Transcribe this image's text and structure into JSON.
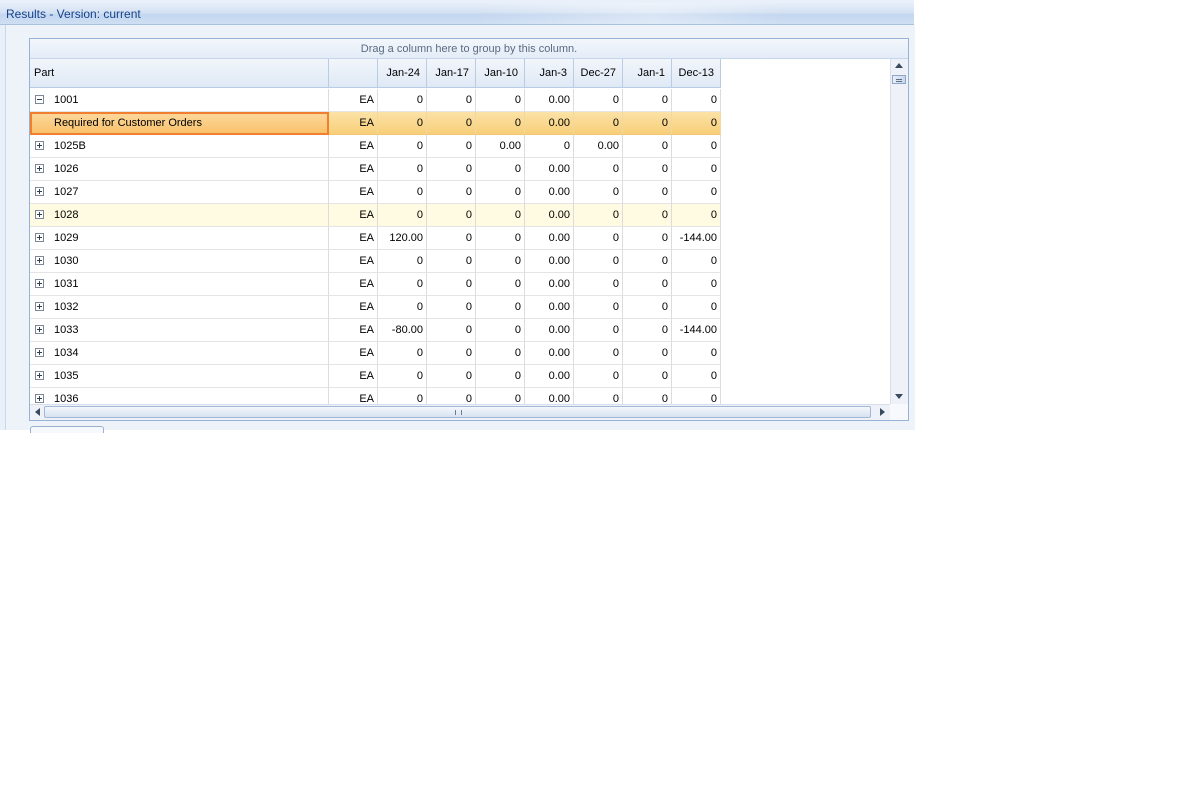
{
  "window": {
    "title": "Results - Version: current"
  },
  "grid": {
    "group_panel_text": "Drag a column here to group by this column.",
    "columns": [
      "Part",
      "",
      "Jan-24",
      "Jan-17",
      "Jan-10",
      "Jan-3",
      "Dec-27",
      "Jan-1",
      "Dec-13"
    ],
    "rows": [
      {
        "part": "1001",
        "expander": "collapse",
        "uom": "EA",
        "values": [
          "0",
          "0",
          "0",
          "0.00",
          "0",
          "0",
          "0"
        ]
      },
      {
        "part": "Required for Customer Orders",
        "expander": "none",
        "uom": "EA",
        "values": [
          "0",
          "0",
          "0",
          "0.00",
          "0",
          "0",
          "0"
        ],
        "state": "selected"
      },
      {
        "part": "1025B",
        "expander": "expand",
        "uom": "EA",
        "values": [
          "0",
          "0",
          "0.00",
          "0",
          "0.00",
          "0",
          "0"
        ]
      },
      {
        "part": "1026",
        "expander": "expand",
        "uom": "EA",
        "values": [
          "0",
          "0",
          "0",
          "0.00",
          "0",
          "0",
          "0"
        ]
      },
      {
        "part": "1027",
        "expander": "expand",
        "uom": "EA",
        "values": [
          "0",
          "0",
          "0",
          "0.00",
          "0",
          "0",
          "0"
        ]
      },
      {
        "part": "1028",
        "expander": "expand",
        "uom": "EA",
        "values": [
          "0",
          "0",
          "0",
          "0.00",
          "0",
          "0",
          "0"
        ],
        "state": "hover"
      },
      {
        "part": "1029",
        "expander": "expand",
        "uom": "EA",
        "values": [
          "120.00",
          "0",
          "0",
          "0.00",
          "0",
          "0",
          "-144.00"
        ]
      },
      {
        "part": "1030",
        "expander": "expand",
        "uom": "EA",
        "values": [
          "0",
          "0",
          "0",
          "0.00",
          "0",
          "0",
          "0"
        ]
      },
      {
        "part": "1031",
        "expander": "expand",
        "uom": "EA",
        "values": [
          "0",
          "0",
          "0",
          "0.00",
          "0",
          "0",
          "0"
        ]
      },
      {
        "part": "1032",
        "expander": "expand",
        "uom": "EA",
        "values": [
          "0",
          "0",
          "0",
          "0.00",
          "0",
          "0",
          "0"
        ]
      },
      {
        "part": "1033",
        "expander": "expand",
        "uom": "EA",
        "values": [
          "-80.00",
          "0",
          "0",
          "0.00",
          "0",
          "0",
          "-144.00"
        ]
      },
      {
        "part": "1034",
        "expander": "expand",
        "uom": "EA",
        "values": [
          "0",
          "0",
          "0",
          "0.00",
          "0",
          "0",
          "0"
        ]
      },
      {
        "part": "1035",
        "expander": "expand",
        "uom": "EA",
        "values": [
          "0",
          "0",
          "0",
          "0.00",
          "0",
          "0",
          "0"
        ]
      },
      {
        "part": "1036",
        "expander": "expand",
        "uom": "EA",
        "values": [
          "0",
          "0",
          "0",
          "0.00",
          "0",
          "0",
          "0"
        ]
      }
    ]
  },
  "colors": {
    "selection": "#f9c26b",
    "selection_border": "#f08030",
    "hover": "#fffbe2",
    "header": "#dfe9f5",
    "title_text": "#15428b"
  },
  "icons": {
    "expand": "plus-box-icon",
    "collapse": "minus-box-icon",
    "scroll_up": "arrow-up-icon",
    "scroll_down": "arrow-down-icon",
    "scroll_left": "arrow-left-icon",
    "scroll_right": "arrow-right-icon"
  }
}
